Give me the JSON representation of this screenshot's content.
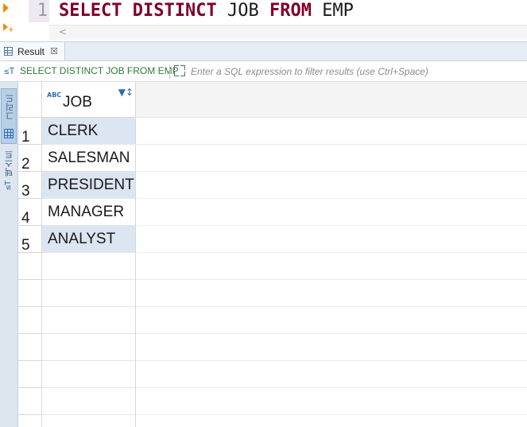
{
  "editor": {
    "line_number": "1",
    "tokens": [
      {
        "text": "SELECT",
        "kind": "kw"
      },
      {
        "text": " ",
        "kind": "ws"
      },
      {
        "text": "DISTINCT",
        "kind": "kw"
      },
      {
        "text": " ",
        "kind": "ws"
      },
      {
        "text": "JOB",
        "kind": "id"
      },
      {
        "text": " ",
        "kind": "ws"
      },
      {
        "text": "FROM",
        "kind": "kw"
      },
      {
        "text": " ",
        "kind": "ws"
      },
      {
        "text": "EMP",
        "kind": "id"
      }
    ],
    "scroll_left_glyph": "<"
  },
  "result_tab": {
    "label": "Result",
    "close_glyph": "☒"
  },
  "filter_bar": {
    "query_icon": "≤T",
    "query_text": "SELECT DISTINCT JOB FROM EMP",
    "placeholder": "Enter a SQL expression to filter results (use Ctrl+Space)"
  },
  "side_panel": {
    "grid_label": "그리드",
    "text_label": "텍스트",
    "text_icon": "≤T"
  },
  "grid": {
    "type_badge": "ABC",
    "sort_glyph": "▼↕",
    "columns": [
      "JOB"
    ],
    "rows": [
      {
        "num": "1",
        "JOB": "CLERK"
      },
      {
        "num": "2",
        "JOB": "SALESMAN"
      },
      {
        "num": "3",
        "JOB": "PRESIDENT"
      },
      {
        "num": "4",
        "JOB": "MANAGER"
      },
      {
        "num": "5",
        "JOB": "ANALYST"
      }
    ]
  },
  "colors": {
    "keyword": "#7f0027",
    "query_text": "#2c7a35",
    "accent": "#2a6fb0",
    "alt_row": "#dce6f2"
  }
}
